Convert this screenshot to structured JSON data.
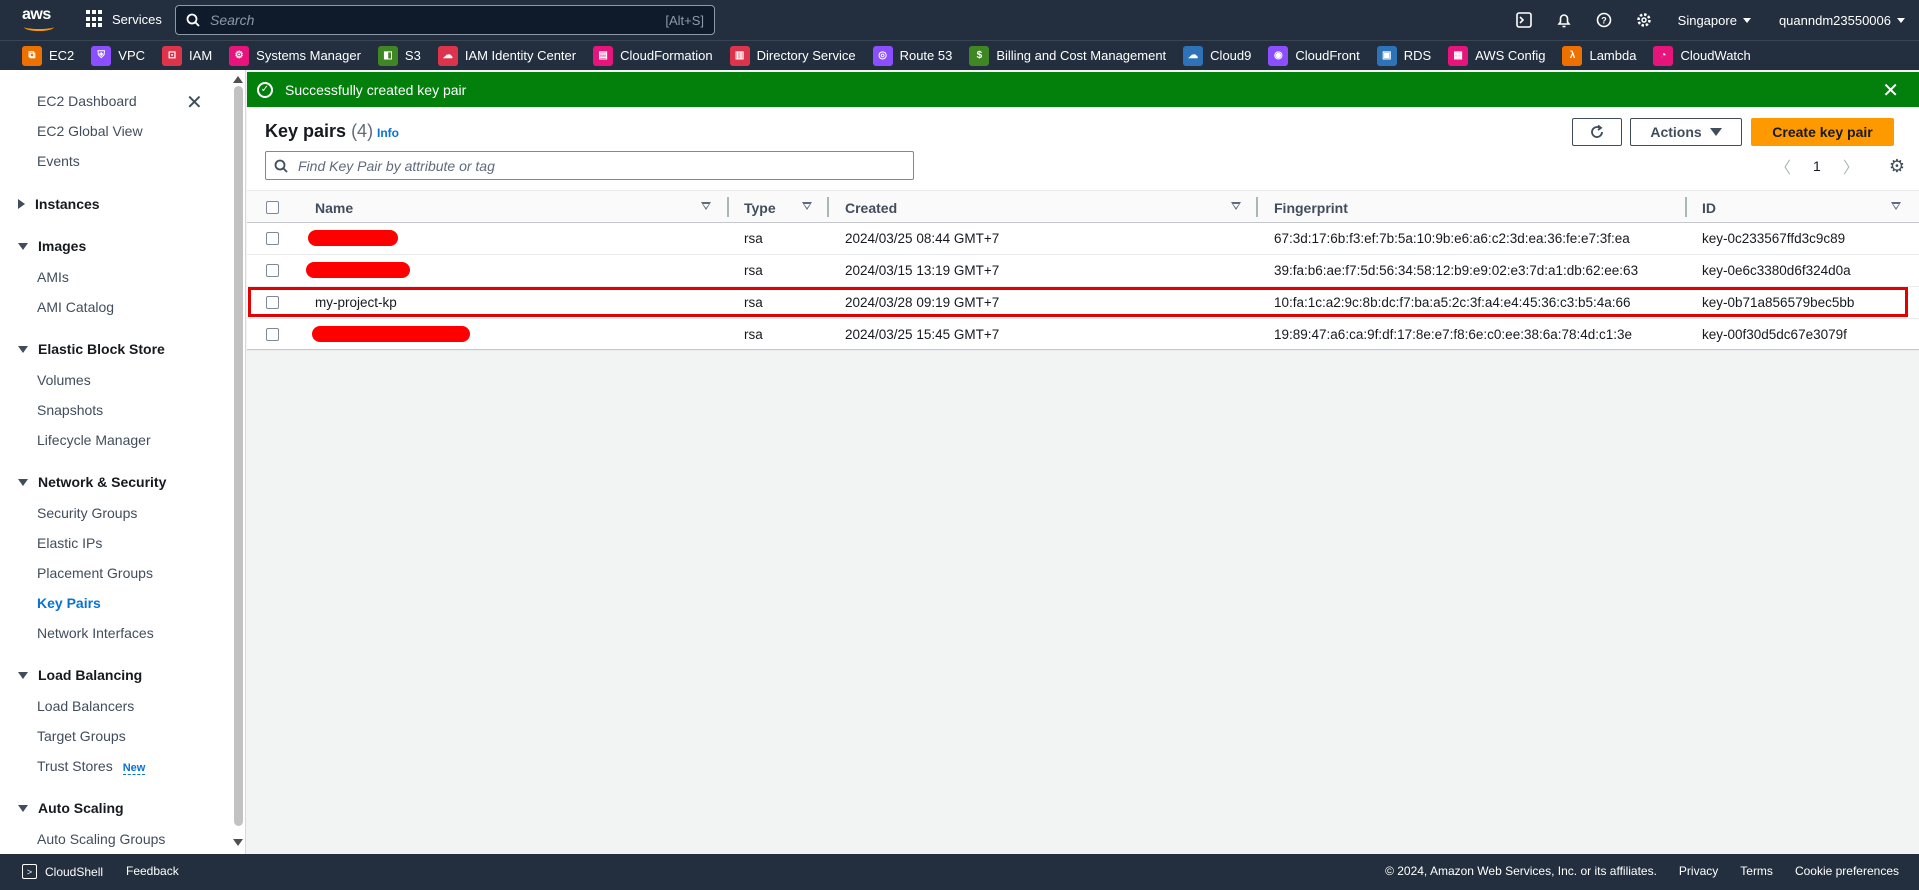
{
  "topnav": {
    "logo_text": "aws",
    "services_label": "Services",
    "search_placeholder": "Search",
    "search_shortcut": "[Alt+S]",
    "region": "Singapore",
    "account": "quanndm23550006"
  },
  "favorites": [
    {
      "label": "EC2",
      "color": "#ed7100",
      "glyph": "⧉"
    },
    {
      "label": "VPC",
      "color": "#8c4fff",
      "glyph": "⛨"
    },
    {
      "label": "IAM",
      "color": "#dd344c",
      "glyph": "⊡"
    },
    {
      "label": "Systems Manager",
      "color": "#e7157b",
      "glyph": "⚙"
    },
    {
      "label": "S3",
      "color": "#3f8624",
      "glyph": "◧"
    },
    {
      "label": "IAM Identity Center",
      "color": "#dd344c",
      "glyph": "☁"
    },
    {
      "label": "CloudFormation",
      "color": "#e7157b",
      "glyph": "▤"
    },
    {
      "label": "Directory Service",
      "color": "#dd344c",
      "glyph": "▥"
    },
    {
      "label": "Route 53",
      "color": "#8c4fff",
      "glyph": "◎"
    },
    {
      "label": "Billing and Cost Management",
      "color": "#3f8624",
      "glyph": "$"
    },
    {
      "label": "Cloud9",
      "color": "#2e73b8",
      "glyph": "☁"
    },
    {
      "label": "CloudFront",
      "color": "#8c4fff",
      "glyph": "◉"
    },
    {
      "label": "RDS",
      "color": "#2e73b8",
      "glyph": "▣"
    },
    {
      "label": "AWS Config",
      "color": "#e7157b",
      "glyph": "▦"
    },
    {
      "label": "Lambda",
      "color": "#ed7100",
      "glyph": "λ"
    },
    {
      "label": "CloudWatch",
      "color": "#e7157b",
      "glyph": "◔"
    }
  ],
  "sidebar": {
    "dashboard": "EC2 Dashboard",
    "global_view": "EC2 Global View",
    "events": "Events",
    "instances": "Instances",
    "images": "Images",
    "amis": "AMIs",
    "ami_catalog": "AMI Catalog",
    "ebs": "Elastic Block Store",
    "volumes": "Volumes",
    "snapshots": "Snapshots",
    "lifecycle": "Lifecycle Manager",
    "netsec": "Network & Security",
    "security_groups": "Security Groups",
    "elastic_ips": "Elastic IPs",
    "placement_groups": "Placement Groups",
    "key_pairs": "Key Pairs",
    "network_interfaces": "Network Interfaces",
    "load_balancing": "Load Balancing",
    "load_balancers": "Load Balancers",
    "target_groups": "Target Groups",
    "trust_stores": "Trust Stores",
    "new_badge": "New",
    "auto_scaling": "Auto Scaling",
    "auto_scaling_groups": "Auto Scaling Groups"
  },
  "flash": {
    "message": "Successfully created key pair"
  },
  "panel": {
    "title": "Key pairs",
    "count": "(4)",
    "info": "Info",
    "actions": "Actions",
    "create": "Create key pair",
    "filter_placeholder": "Find Key Pair by attribute or tag",
    "page": "1"
  },
  "table": {
    "headers": {
      "name": "Name",
      "type": "Type",
      "created": "Created",
      "fingerprint": "Fingerprint",
      "id": "ID"
    },
    "rows": [
      {
        "name": "",
        "type": "rsa",
        "created": "2024/03/25 08:44 GMT+7",
        "fingerprint": "67:3d:17:6b:f3:ef:7b:5a:10:9b:e6:a6:c2:3d:ea:36:fe:e7:3f:ea",
        "id": "key-0c233567ffd3c9c89"
      },
      {
        "name": "",
        "type": "rsa",
        "created": "2024/03/15 13:19 GMT+7",
        "fingerprint": "39:fa:b6:ae:f7:5d:56:34:58:12:b9:e9:02:e3:7d:a1:db:62:ee:63",
        "id": "key-0e6c3380d6f324d0a"
      },
      {
        "name": "my-project-kp",
        "type": "rsa",
        "created": "2024/03/28 09:19 GMT+7",
        "fingerprint": "10:fa:1c:a2:9c:8b:dc:f7:ba:a5:2c:3f:a4:e4:45:36:c3:b5:4a:66",
        "id": "key-0b71a856579bec5bb"
      },
      {
        "name": "",
        "type": "rsa",
        "created": "2024/03/25 15:45 GMT+7",
        "fingerprint": "19:89:47:a6:ca:9f:df:17:8e:e7:f8:6e:c0:ee:38:6a:78:4d:c1:3e",
        "id": "key-00f30d5dc67e3079f"
      }
    ]
  },
  "footer": {
    "cloudshell": "CloudShell",
    "feedback": "Feedback",
    "copyright": "© 2024, Amazon Web Services, Inc. or its affiliates.",
    "privacy": "Privacy",
    "terms": "Terms",
    "cookies": "Cookie preferences"
  }
}
